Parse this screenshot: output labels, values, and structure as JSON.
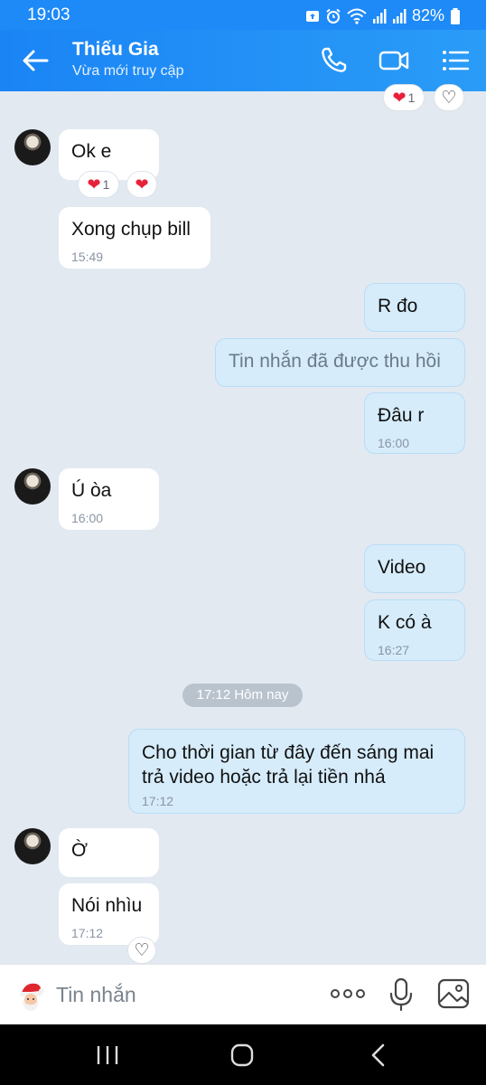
{
  "status_bar": {
    "time": "19:03",
    "battery": "82%"
  },
  "header": {
    "name": "Thiếu Gia",
    "status": "Vừa mới truy cập"
  },
  "messages": {
    "top_reaction_count": "1",
    "m1": {
      "text": "Ok e",
      "reaction_count": "1"
    },
    "m2": {
      "text": "Xong chụp bill",
      "time": "15:49"
    },
    "m3": {
      "text": "R đo"
    },
    "m4": {
      "text": "Tin nhắn đã được thu hồi"
    },
    "m5": {
      "text": "Đâu r",
      "time": "16:00"
    },
    "m6": {
      "text": "Ú òa",
      "time": "16:00"
    },
    "m7": {
      "text": "Video"
    },
    "m8": {
      "text": "K có à",
      "time": "16:27"
    },
    "divider": "17:12 Hôm nay",
    "m9": {
      "line1": "Cho thời gian từ đây đến sáng mai",
      "line2": "trả video hoặc trả lại tiền nhá",
      "time": "17:12"
    },
    "m10": {
      "text": "Ờ"
    },
    "m11": {
      "text": "Nói nhìu",
      "time": "17:12"
    }
  },
  "input": {
    "placeholder": "Tin nhắn"
  },
  "icons": {
    "back": "arrow-left-icon",
    "call": "phone-icon",
    "video": "video-camera-icon",
    "menu": "list-menu-icon",
    "heart": "heart-icon",
    "emoji": "santa-sticker-icon",
    "more": "more-dots-icon",
    "mic": "microphone-icon",
    "image": "image-icon"
  },
  "colors": {
    "header": "#1a84f5",
    "background": "#e2e9f1",
    "outgoing_bubble": "#d6ecfb",
    "incoming_bubble": "#ffffff",
    "heart": "#e8213b"
  }
}
